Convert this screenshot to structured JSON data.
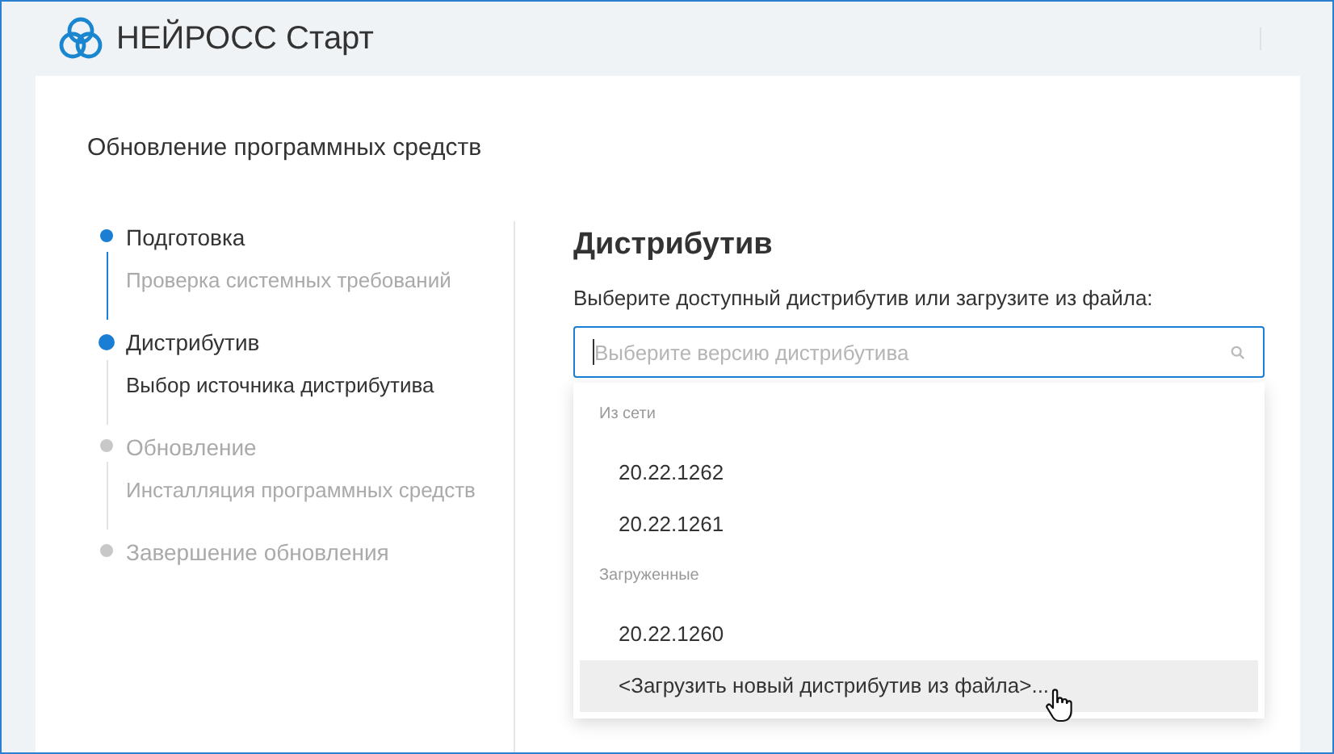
{
  "app": {
    "title": "НЕЙРОСС Старт"
  },
  "page": {
    "title": "Обновление программных средств"
  },
  "steps": [
    {
      "title": "Подготовка",
      "subtitle": "Проверка системных требований",
      "completed": true,
      "active": false
    },
    {
      "title": "Дистрибутив",
      "subtitle": "Выбор источника дистрибутива",
      "completed": false,
      "active": true
    },
    {
      "title": "Обновление",
      "subtitle": "Инсталляция программных средств",
      "completed": false,
      "active": false
    },
    {
      "title": "Завершение обновления",
      "completed": false,
      "active": false
    }
  ],
  "panel": {
    "title": "Дистрибутив",
    "prompt": "Выберите доступный дистрибутив или загрузите из файла:",
    "select": {
      "placeholder": "Выберите версию дистрибутива",
      "options": [
        {
          "kind": "group",
          "label": "Из сети"
        },
        {
          "kind": "option",
          "label": "20.22.1262",
          "hovered": false
        },
        {
          "kind": "option",
          "label": "20.22.1261",
          "hovered": false
        },
        {
          "kind": "group",
          "label": "Загруженные"
        },
        {
          "kind": "option",
          "label": "20.22.1260",
          "hovered": false
        },
        {
          "kind": "option",
          "label": "<Загрузить новый дистрибутив из файла>...",
          "hovered": true
        }
      ]
    }
  }
}
